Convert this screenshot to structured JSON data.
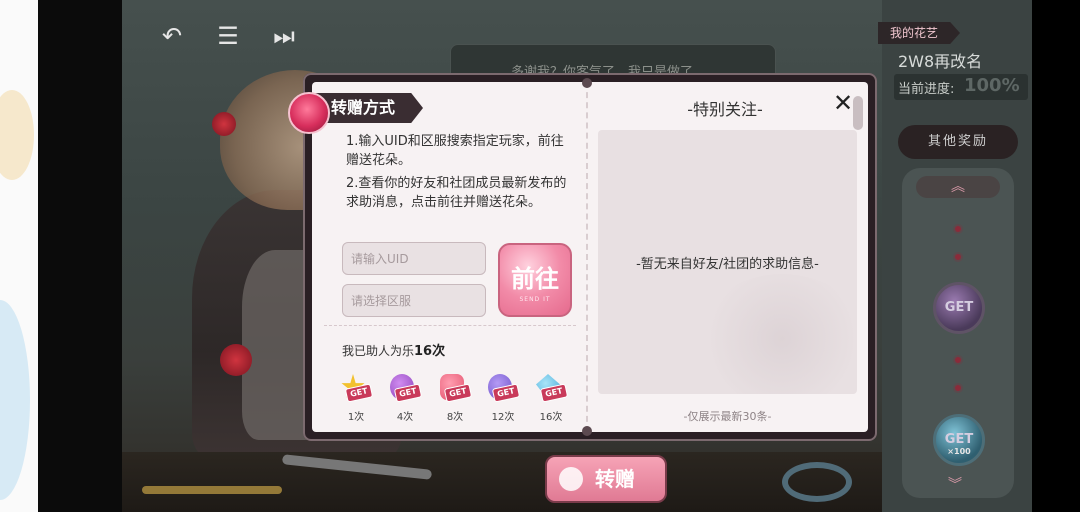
{
  "top_nav": {
    "back_icon": "back-arrow-icon",
    "menu_icon": "list-icon",
    "skip_icon": "skip-icon"
  },
  "background": {
    "top_banner_text": "多谢我？你客气了，我只是做了"
  },
  "right_panel": {
    "tag": "我的花艺",
    "player_name": "2W8再改名",
    "progress_label": "当前进度:",
    "progress_value": "100%",
    "other_rewards_label": "其他奖励",
    "get_label": "GET",
    "get_count": "×100"
  },
  "bottom": {
    "send_button_label": "转赠"
  },
  "dialog": {
    "left": {
      "tag": "转赠方式",
      "instruction_1": "1.输入UID和区服搜索指定玩家，前往赠送花朵。",
      "instruction_2": "2.查看你的好友和社团成员最新发布的求助消息，点击前往并赠送花朵。",
      "uid_placeholder": "请输入UID",
      "server_placeholder": "请选择区服",
      "go_button_label": "前往",
      "go_button_sub": "SEND IT",
      "helped_prefix": "我已助人为乐",
      "helped_count": "16次",
      "rewards": [
        {
          "count": "1次",
          "icon": "yellow-star-icon",
          "color": "#f2c12e"
        },
        {
          "count": "4次",
          "icon": "purple-gem-icon",
          "color": "#8a3fb8"
        },
        {
          "count": "8次",
          "icon": "pink-bag-icon",
          "color": "#e4536e"
        },
        {
          "count": "12次",
          "icon": "purple-crystal-icon",
          "color": "#6b4fc6"
        },
        {
          "count": "16次",
          "icon": "blue-diamond-icon",
          "color": "#3fa5d8"
        }
      ],
      "get_badge": "GET"
    },
    "right": {
      "title": "-特别关注-",
      "empty_message": "-暂无来自好友/社团的求助信息-",
      "footnote": "-仅展示最新30条-"
    },
    "close_icon": "close-icon"
  }
}
